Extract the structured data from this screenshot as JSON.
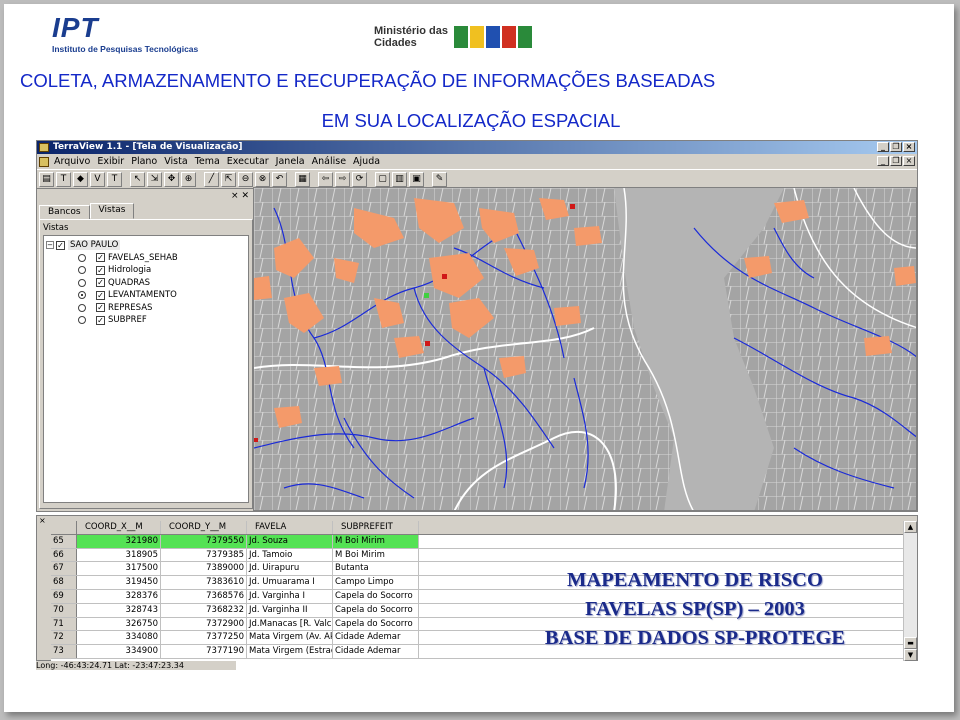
{
  "logos": {
    "ipt_mark": "IPT",
    "ipt_sub": "Instituto de Pesquisas Tecnológicas",
    "ministerio": "Ministério das Cidades"
  },
  "title": {
    "line1": "COLETA, ARMAZENAMENTO E RECUPERAÇÃO DE INFORMAÇÕES BASEADAS",
    "line2": "EM SUA LOCALIZAÇÃO ESPACIAL"
  },
  "app": {
    "window_title": "TerraView 1.1 - [Tela de Visualização]",
    "menu": [
      "Arquivo",
      "Exibir",
      "Plano",
      "Vista",
      "Tema",
      "Executar",
      "Janela",
      "Análise",
      "Ajuda"
    ],
    "tabs": [
      "Bancos",
      "Vistas"
    ],
    "panel_label": "Vistas",
    "tree_root": "SAO PAULO",
    "layers": [
      {
        "label": "FAVELAS_SEHAB",
        "checked": true
      },
      {
        "label": "Hidrologia",
        "checked": true
      },
      {
        "label": "QUADRAS",
        "checked": true
      },
      {
        "label": "LEVANTAMENTO",
        "checked": true
      },
      {
        "label": "REPRESAS",
        "checked": true
      },
      {
        "label": "SUBPREF",
        "checked": true
      }
    ],
    "status": "Long: -46:43:24.71 Lat: -23:47:23.34"
  },
  "table": {
    "columns": [
      "COORD_X__M",
      "COORD_Y__M",
      "FAVELA",
      "SUBPREFEIT"
    ],
    "rows": [
      {
        "idx": "65",
        "x": "321980",
        "y": "7379550",
        "favela": "Jd. Souza",
        "subpref": "M Boi Mirim"
      },
      {
        "idx": "66",
        "x": "318905",
        "y": "7379385",
        "favela": "Jd. Tamoio",
        "subpref": "M Boi Mirim"
      },
      {
        "idx": "67",
        "x": "317500",
        "y": "7389000",
        "favela": "Jd. Uirapuru",
        "subpref": "Butanta"
      },
      {
        "idx": "68",
        "x": "319450",
        "y": "7383610",
        "favela": "Jd. Umuarama I",
        "subpref": "Campo Limpo"
      },
      {
        "idx": "69",
        "x": "328376",
        "y": "7368576",
        "favela": "Jd. Varginha I",
        "subpref": "Capela do Socorro"
      },
      {
        "idx": "70",
        "x": "328743",
        "y": "7368232",
        "favela": "Jd. Varginha II",
        "subpref": "Capela do Socorro"
      },
      {
        "idx": "71",
        "x": "326750",
        "y": "7372900",
        "favela": "Jd.Manacas [R. Valc",
        "subpref": "Capela do Socorro"
      },
      {
        "idx": "72",
        "x": "334080",
        "y": "7377250",
        "favela": "Mata Virgem (Av. Ak",
        "subpref": "Cidade Ademar"
      },
      {
        "idx": "73",
        "x": "334900",
        "y": "7377190",
        "favela": "Mata Virgem (Estrad",
        "subpref": "Cidade Ademar"
      }
    ]
  },
  "caption": {
    "line1": "MAPEAMENTO DE RISCO",
    "line2": "FAVELAS SP(SP) – 2003",
    "line3": "BASE DE DADOS SP-PROTEGE"
  },
  "colors": {
    "title": "#1428c8",
    "caption": "#1a2a8a",
    "favela_fill": "#f49a6a",
    "river": "#1a2ad8",
    "highlight_row": "#54e254"
  }
}
